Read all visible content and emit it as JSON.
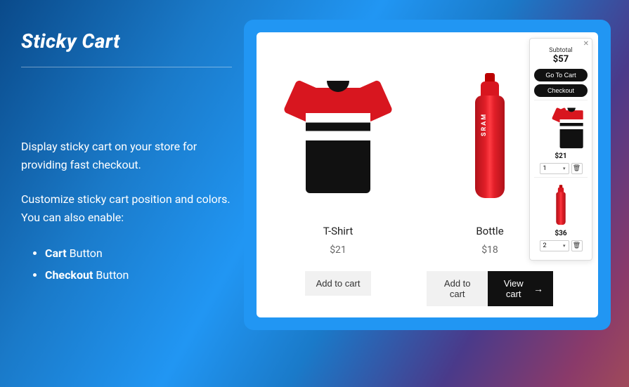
{
  "left": {
    "title": "Sticky Cart",
    "p1": "Display sticky cart on your store for providing fast checkout.",
    "p2": "Customize sticky cart position and colors. You can also enable:",
    "bullets": [
      {
        "bold": "Cart",
        "rest": " Button"
      },
      {
        "bold": "Checkout",
        "rest": " Button"
      }
    ]
  },
  "products": [
    {
      "name": "T-Shirt",
      "price": "$21",
      "add": "Add to cart"
    },
    {
      "name": "Bottle",
      "price": "$18",
      "add": "Add to cart",
      "view": "View cart"
    }
  ],
  "sticky": {
    "subtotal_label": "Subtotal",
    "subtotal_value": "$57",
    "go_to_cart": "Go To Cart",
    "checkout": "Checkout",
    "items": [
      {
        "price": "$21",
        "qty": "1"
      },
      {
        "price": "$36",
        "qty": "2"
      }
    ]
  }
}
